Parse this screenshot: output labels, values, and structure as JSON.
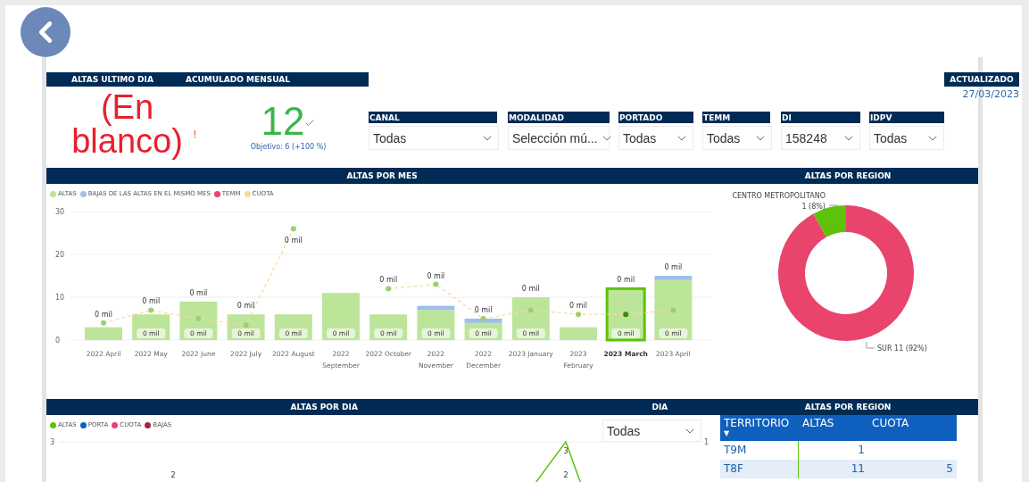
{
  "header": {
    "kpi_titles": [
      "ALTAS ULTIMO DIA",
      "ACUMULADO MENSUAL"
    ],
    "updated_label": "ACTUALIZADO",
    "updated_date": "27/03/2023"
  },
  "kpis": [
    {
      "kind": "blank",
      "value": "(En blanco)",
      "warning": "!"
    },
    {
      "kind": "target",
      "value": "12",
      "met": true,
      "target": "Objetivo: 6 (+100 %)"
    }
  ],
  "slicers": [
    {
      "label": "CANAL",
      "value": "Todas"
    },
    {
      "label": "MODALIDAD",
      "value": "Selección mú..."
    },
    {
      "label": "PORTADO",
      "value": "Todas"
    },
    {
      "label": "TEMM",
      "value": "Todas"
    },
    {
      "label": "DI",
      "value": "158248"
    },
    {
      "label": "IDPV",
      "value": "Todas"
    }
  ],
  "monthly": {
    "title": "ALTAS POR MES",
    "chart_data": {
      "type": "bar",
      "stacked": true,
      "categories": [
        "2022 April",
        "2022 May",
        "2022 June",
        "2022 July",
        "2022 August",
        "2022 September",
        "2022 October",
        "2022 November",
        "2022 December",
        "2023 January",
        "2023 February",
        "2023 March",
        "2023 April"
      ],
      "series": [
        {
          "name": "ALTAS",
          "color": "#bde59a",
          "values": [
            3,
            6,
            9,
            6,
            6,
            11,
            6,
            7,
            4,
            10,
            3,
            12,
            14
          ]
        },
        {
          "name": "BAJAS DE LAS ALTAS EN EL MISMO MES",
          "color": "#9fbfe6",
          "values": [
            0,
            0,
            0,
            0,
            0,
            0,
            0,
            1,
            1,
            0,
            0,
            0,
            1
          ]
        },
        {
          "name": "TEMM",
          "color": "#e8446c",
          "type": "line",
          "values": [
            null,
            null,
            null,
            null,
            null,
            null,
            null,
            null,
            null,
            null,
            null,
            null,
            null
          ]
        },
        {
          "name": "CUOTA",
          "color": "#fbd79d",
          "type": "line",
          "line_style": "dashed",
          "marker": "circle",
          "values": [
            4,
            7,
            5,
            3.5,
            26,
            null,
            12,
            13,
            5,
            7,
            6,
            6,
            7
          ]
        }
      ],
      "legend": "top",
      "ylim": [
        0,
        30
      ],
      "yticks": [
        0,
        10,
        20,
        30
      ],
      "value_labels": [
        null,
        "0 mil",
        "0 mil",
        "0 mil",
        "0 mil",
        "0 mil",
        "0 mil",
        "0 mil",
        "0 mil",
        "0 mil",
        null,
        "0 mil",
        "0 mil"
      ],
      "annotations": [
        "0 mil",
        "0 mil",
        "0 mil",
        "0 mil",
        "0 mil",
        null,
        "0 mil",
        "0 mil",
        "0 mil",
        "0 mil",
        "0 mil",
        "0 mil",
        "0 mil"
      ]
    },
    "selected": [
      false,
      false,
      false,
      false,
      false,
      false,
      false,
      false,
      false,
      false,
      false,
      true,
      false
    ]
  },
  "region": {
    "title": "ALTAS POR REGION",
    "chart_data": {
      "type": "donut",
      "categories": [
        "CENTRO METROPOLITANO",
        "SUR"
      ],
      "series": [
        {
          "values": [
            8,
            92
          ]
        }
      ],
      "colors": [
        "#5ec20a",
        "#e8446c"
      ],
      "value_labels": [
        "1 (8%)",
        "11 (92%)"
      ]
    }
  },
  "daily": {
    "title": "ALTAS POR DIA",
    "legend": [
      {
        "name": "ALTAS",
        "color": "#5ec20a"
      },
      {
        "name": "PORTA",
        "color": "#0f5fbf"
      },
      {
        "name": "CUOTA",
        "color": "#e8446c"
      },
      {
        "name": "BAJAS",
        "color": "#a3263f"
      }
    ],
    "left_tick": "3",
    "right_tick": "1",
    "point_labels": [
      "3",
      "2",
      "2"
    ]
  },
  "day_filter": {
    "label": "DIA",
    "value": "Todas"
  },
  "region_table": {
    "title": "ALTAS POR REGION",
    "columns": [
      "TERRITORIO",
      "ALTAS",
      "CUOTA"
    ],
    "sort_marker": "▼",
    "rows": [
      [
        "T9M",
        "1",
        ""
      ],
      [
        "T8F",
        "11",
        "5"
      ]
    ]
  }
}
